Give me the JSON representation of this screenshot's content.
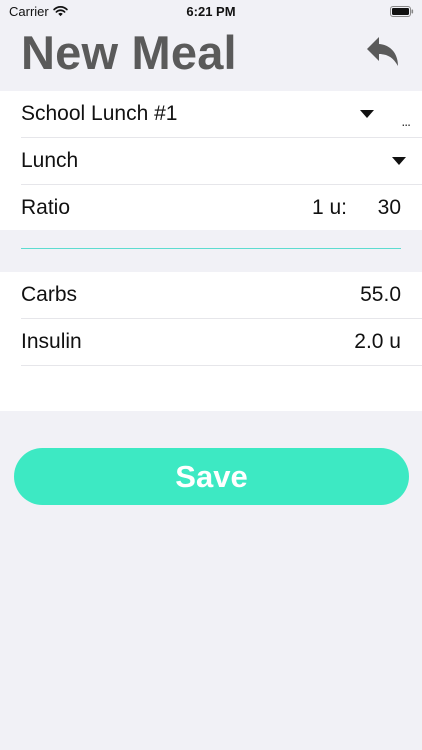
{
  "status_bar": {
    "carrier": "Carrier",
    "time": "6:21 PM",
    "icons": [
      "wifi-icon",
      "battery-icon"
    ]
  },
  "header": {
    "title": "New Meal",
    "back_icon": "reply-arrow-icon"
  },
  "form": {
    "meal_select": {
      "value": "School Lunch #1",
      "more_label": "..."
    },
    "meal_type_select": {
      "value": "Lunch"
    },
    "ratio": {
      "label": "Ratio",
      "prefix": "1 u:",
      "value": "30"
    },
    "carbs": {
      "label": "Carbs",
      "value": "55.0"
    },
    "insulin": {
      "label": "Insulin",
      "value": "2.0 u"
    }
  },
  "actions": {
    "save_label": "Save"
  },
  "colors": {
    "accent": "#3de9c3",
    "divider_line": "#5ddcd0",
    "title_gray": "#5a5a5a",
    "background": "#f1f1f6"
  }
}
